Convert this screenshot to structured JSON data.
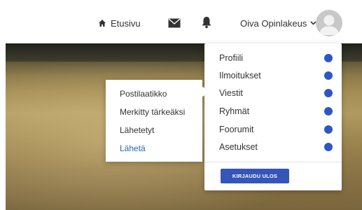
{
  "topbar": {
    "home_label": "Etusivu",
    "user_name": "Oiva Opinlakeus",
    "icons": {
      "home": "home-icon",
      "mail": "envelope-icon",
      "bell": "bell-icon",
      "caret": "chevron-down-icon",
      "avatar": "user-avatar"
    }
  },
  "user_menu": {
    "items": [
      {
        "label": "Profiili"
      },
      {
        "label": "Ilmoitukset"
      },
      {
        "label": "Viestit"
      },
      {
        "label": "Ryhmät"
      },
      {
        "label": "Foorumit"
      },
      {
        "label": "Asetukset"
      }
    ],
    "logout_label": "KIRJAUDU ULOS",
    "dot_color": "#2d56c9"
  },
  "messages_submenu": {
    "items": [
      {
        "label": "Postilaatikko",
        "active": false
      },
      {
        "label": "Merkitty tärkeäksi",
        "active": false
      },
      {
        "label": "Lähetetyt",
        "active": false
      },
      {
        "label": "Lähetä",
        "active": true
      }
    ],
    "active_color": "#2d5fc9"
  }
}
